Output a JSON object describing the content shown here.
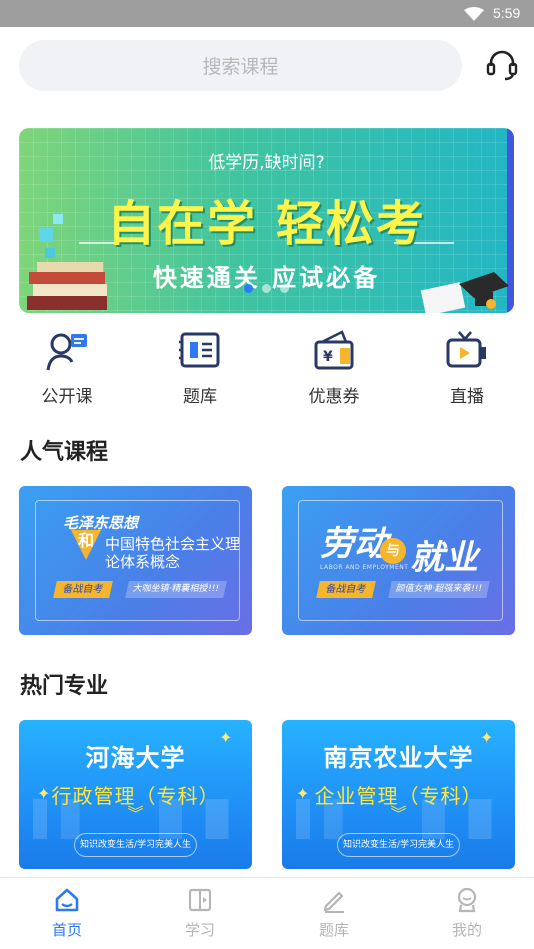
{
  "status_bar": {
    "time": "5:59"
  },
  "search": {
    "placeholder": "搜索课程"
  },
  "banner": {
    "subtitle": "低学历,缺时间?",
    "headline": "自在学 轻松考",
    "tagline": "快速通关 应试必备",
    "slides": 3,
    "active_slide": 1
  },
  "quick_menu": [
    {
      "label": "公开课",
      "icon": "open-class-icon"
    },
    {
      "label": "题库",
      "icon": "question-bank-icon"
    },
    {
      "label": "优惠券",
      "icon": "coupon-icon"
    },
    {
      "label": "直播",
      "icon": "live-tv-icon"
    }
  ],
  "popular_courses": {
    "title": "人气课程",
    "items": [
      {
        "line1": "毛泽东思想",
        "connector": "和",
        "line2": "中国特色社会主义理论体系概念",
        "badge": "备战自考",
        "slogan": "大咖坐镇·精囊相授!!!"
      },
      {
        "word1": "劳动",
        "connector": "与",
        "word2": "就业",
        "small": "LABOR AND EMPLOYMENT",
        "badge": "备战自考",
        "slogan": "颜值女神·超强来袭!!!"
      }
    ]
  },
  "hot_majors": {
    "title": "热门专业",
    "items": [
      {
        "school": "河海大学",
        "major": "行政管理（专科）",
        "footer": "知识改变生活/学习完美人生"
      },
      {
        "school": "南京农业大学",
        "major": "企业管理（专科）",
        "footer": "知识改变生活/学习完美人生"
      }
    ]
  },
  "tabbar": [
    {
      "label": "首页",
      "icon": "home-icon",
      "active": true
    },
    {
      "label": "学习",
      "icon": "study-icon",
      "active": false
    },
    {
      "label": "题库",
      "icon": "pencil-icon",
      "active": false
    },
    {
      "label": "我的",
      "icon": "profile-icon",
      "active": false
    }
  ],
  "colors": {
    "accent": "#2f78f0",
    "indicator": "#2f7bf6",
    "banner_text": "#fff44a"
  }
}
